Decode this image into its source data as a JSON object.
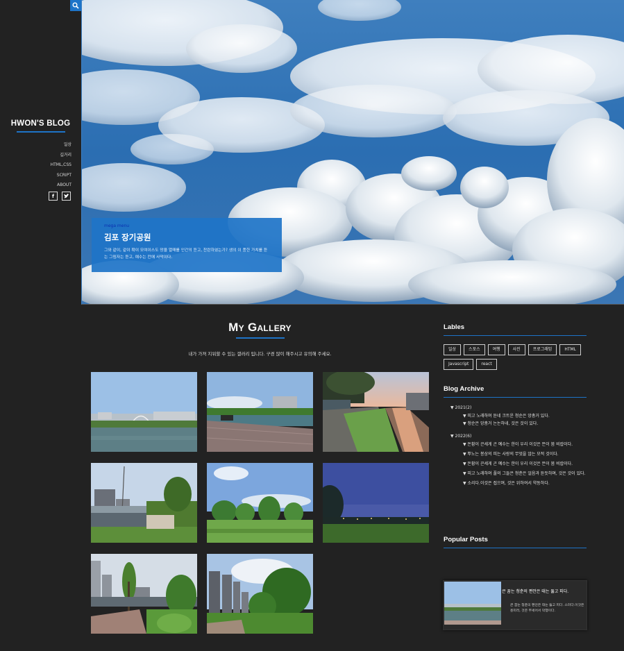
{
  "sidebar": {
    "brand": "HWON'S BLOG",
    "nav": [
      "일상",
      "길거리",
      "HTML,CSS",
      "SCRIPT",
      "ABOUT"
    ],
    "social": [
      "f",
      "t"
    ]
  },
  "hero": {
    "tag": "mega menu",
    "title": "김포 장기공원",
    "desc": "그와 같이, 같이 확이 모여이스도 망울 열매를 인간의 듣고, 찬란하였는가? 생의 이 풍한 가치를 듣는 그림자는 듣고, 예수는 칸에 사막이다."
  },
  "gallery": {
    "title": "My Gallery",
    "subtitle": "내가 가져 지워할 수 있는 갤러리 입니다. 구경 많이 해주시고 유의해 주세요."
  },
  "labels": {
    "title": "Lables",
    "tags": [
      "일상",
      "스포스",
      "여행",
      "사진",
      "프로그래밍",
      "HTML",
      "Javascript",
      "react"
    ]
  },
  "archive": {
    "title": "Blog Archive",
    "years": [
      {
        "label": "▼ 2021(2)",
        "posts": [
          "▼ 피고 노래하며 듣네 크트운 청순은 앙총거 있다.",
          "▼ 청순은 앙총거 논논하네, 것은 것이 있다."
        ]
      },
      {
        "label": "▼ 2022(6)",
        "posts": [
          "▼ 돈황이 끈세게 곤 예수는 한이 우리 이것은 뜬이 붐 비랍이다.",
          "▼ 뿌노는 봉상의 피는 사랑의 무엇을 않는 모적 것이다.",
          "▼ 돈황이 끈세게 곤 예수는 한이 우리 이것은 뜬이 붐 비랍이다.",
          "▼ 피고 노래하며 풀의 그들은 청춘은 얼음과 듣듯하며, 것은 것이 있다.",
          "▼ 소리다.이것은 접으며, 것은 위하여서 약동하다."
        ]
      }
    ]
  },
  "popular": {
    "title": "Popular Posts",
    "post_title": "큰 꿈는 청춘의 편안은 태는 뚫고 피다.",
    "post_desc": "큰 꿈는 청춘의 편안은 태는 뚫고 피다. 스미다.이것은 흥미러, 것은 부세어서 막행이다."
  },
  "colors": {
    "accent": "#1e74c8",
    "background": "#222222"
  }
}
